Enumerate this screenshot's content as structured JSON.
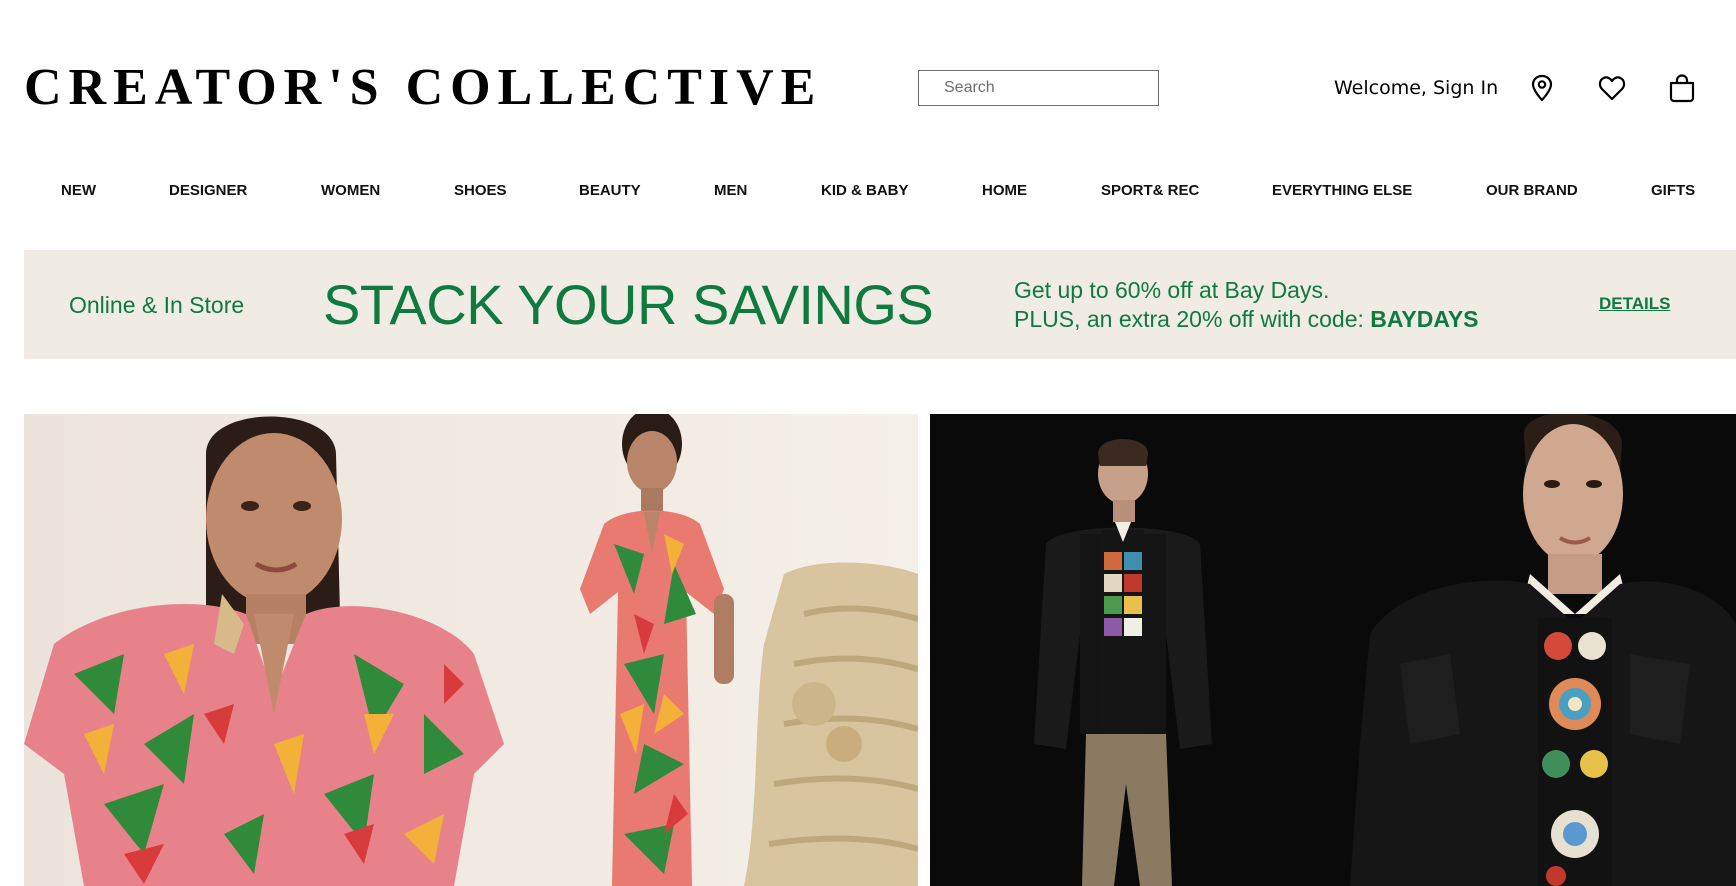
{
  "header": {
    "logo": "CREATOR'S COLLECTIVE",
    "search_placeholder": "Search",
    "welcome_text": "Welcome, Sign In",
    "icons": [
      "location-pin-icon",
      "heart-icon",
      "shopping-bag-icon"
    ]
  },
  "nav": {
    "items": [
      "NEW",
      "DESIGNER",
      "WOMEN",
      "SHOES",
      "BEAUTY",
      "MEN",
      "KID & BABY",
      "HOME",
      "SPORT& REC",
      "EVERYTHING ELSE",
      "OUR BRAND",
      "GIFTS"
    ]
  },
  "promo_banner": {
    "left_text": "Online & In Store",
    "headline": "STACK YOUR SAVINGS",
    "line1": "Get up to 60% off at Bay Days.",
    "line2_prefix": "PLUS, an extra 20% off with code: ",
    "code": "BAYDAYS",
    "details_link": "DETAILS",
    "accent_color": "#0e7a3f",
    "background_color": "#f0ece3"
  },
  "hero_tiles": [
    {
      "subject": "women-tropical-print-dress-photo"
    },
    {
      "subject": "men-leather-jacket-crochet-sweater-photo"
    }
  ]
}
